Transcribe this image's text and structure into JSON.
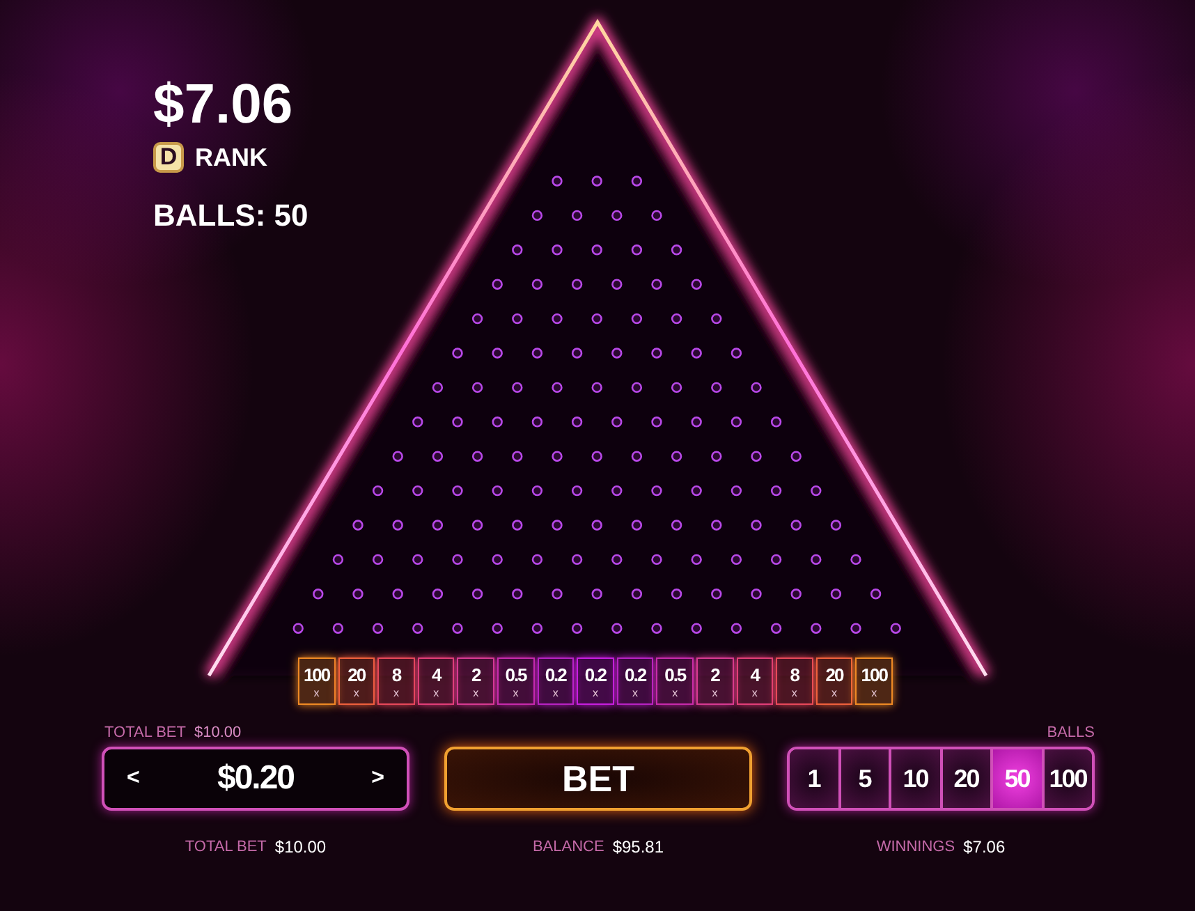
{
  "stats": {
    "amount": "$7.06",
    "rank_badge": "D",
    "rank_label": "RANK",
    "balls": "BALLS: 50"
  },
  "slots": [
    {
      "value": "100",
      "suffix": "x",
      "color": "#f08a24"
    },
    {
      "value": "20",
      "suffix": "x",
      "color": "#f0603c"
    },
    {
      "value": "8",
      "suffix": "x",
      "color": "#e8485a"
    },
    {
      "value": "4",
      "suffix": "x",
      "color": "#e23e78"
    },
    {
      "value": "2",
      "suffix": "x",
      "color": "#d83a92"
    },
    {
      "value": "0.5",
      "suffix": "x",
      "color": "#c82aac"
    },
    {
      "value": "0.2",
      "suffix": "x",
      "color": "#b822c4"
    },
    {
      "value": "0.2",
      "suffix": "x",
      "color": "#c81ee0"
    },
    {
      "value": "0.2",
      "suffix": "x",
      "color": "#b822c4"
    },
    {
      "value": "0.5",
      "suffix": "x",
      "color": "#c82aac"
    },
    {
      "value": "2",
      "suffix": "x",
      "color": "#d83a92"
    },
    {
      "value": "4",
      "suffix": "x",
      "color": "#e23e78"
    },
    {
      "value": "8",
      "suffix": "x",
      "color": "#e8485a"
    },
    {
      "value": "20",
      "suffix": "x",
      "color": "#f0603c"
    },
    {
      "value": "100",
      "suffix": "x",
      "color": "#f08a24"
    }
  ],
  "bet_control": {
    "label": "TOTAL BET",
    "total": "$10.00",
    "prev": "<",
    "value": "$0.20",
    "next": ">"
  },
  "bet_button": "BET",
  "balls_selector": {
    "label": "BALLS",
    "options": [
      {
        "label": "1",
        "selected": false
      },
      {
        "label": "5",
        "selected": false
      },
      {
        "label": "10",
        "selected": false
      },
      {
        "label": "20",
        "selected": false
      },
      {
        "label": "50",
        "selected": true
      },
      {
        "label": "100",
        "selected": false
      }
    ]
  },
  "footer": [
    {
      "label": "TOTAL BET",
      "value": "$10.00"
    },
    {
      "label": "BALANCE",
      "value": "$95.81"
    },
    {
      "label": "WINNINGS",
      "value": "$7.06"
    }
  ]
}
